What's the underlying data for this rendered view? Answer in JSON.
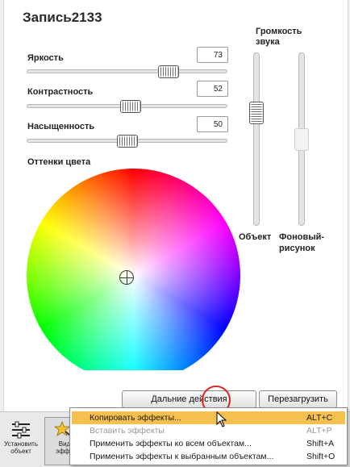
{
  "title": "Запись2133",
  "sliders": [
    {
      "label": "Яркость",
      "value": "73",
      "level": 0.73
    },
    {
      "label": "Контрастность",
      "value": "52",
      "level": 0.52
    },
    {
      "label": "Насыщенность",
      "value": "50",
      "level": 0.5
    }
  ],
  "hue_label": "Оттенки цвета",
  "volume": {
    "title_line1": "Громкость",
    "title_line2": "звука",
    "object_label": "Объект",
    "background_label_line1": "Фоновый-",
    "background_label_line2": "рисунок"
  },
  "buttons": {
    "more_actions": "Дальние действия",
    "reload": "Перезагрузить"
  },
  "toolbar": {
    "install_line1": "Установить",
    "install_line2": "объект",
    "effects_line1": "Вид",
    "effects_line2": "эффе"
  },
  "menu": {
    "items": [
      {
        "label": "Копировать эффекты...",
        "shortcut": "ALT+C",
        "state": "highlighted"
      },
      {
        "label": "Вставить эффекты",
        "shortcut": "ALT+P",
        "state": "disabled"
      },
      {
        "label": "Применить эффекты ко всем объектам...",
        "shortcut": "Shift+A",
        "state": "normal"
      },
      {
        "label": "Применить эффекты к выбранным объектам...",
        "shortcut": "Shift+O",
        "state": "normal"
      }
    ]
  },
  "colors": {
    "menu_highlight": "#f6c04e",
    "highlight_ring": "#e02020"
  },
  "icons": [
    "sliders-icon",
    "star-wand-icon",
    "mouse-pointer-icon",
    "picker-crosshair-icon"
  ]
}
